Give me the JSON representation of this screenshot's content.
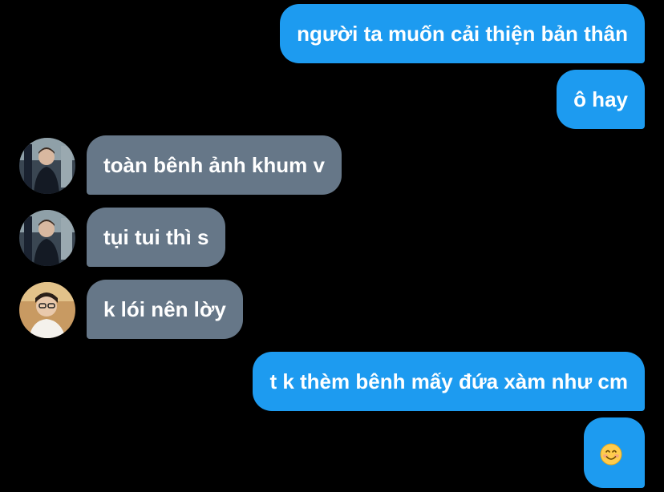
{
  "messages": [
    {
      "side": "sent",
      "text": "người ta muốn cải thiện bản thân"
    },
    {
      "side": "sent",
      "text": "ô hay"
    },
    {
      "side": "received",
      "avatar": "avatar-photo-user-1",
      "text": "toàn bênh ảnh khum v"
    },
    {
      "side": "received",
      "avatar": "avatar-photo-user-1",
      "text": "tụi tui thì s"
    },
    {
      "side": "received",
      "avatar": "avatar-photo-user-2",
      "text": "k lói nên lờy"
    },
    {
      "side": "sent",
      "text": "t k thèm bênh mấy đứa xàm như cm"
    },
    {
      "side": "sent",
      "text": "",
      "emoji": "smiling-face-emoji"
    }
  ],
  "colors": {
    "background": "#000000",
    "sent_bubble": "#1d9bf0",
    "received_bubble": "#667788",
    "text": "#ffffff"
  }
}
